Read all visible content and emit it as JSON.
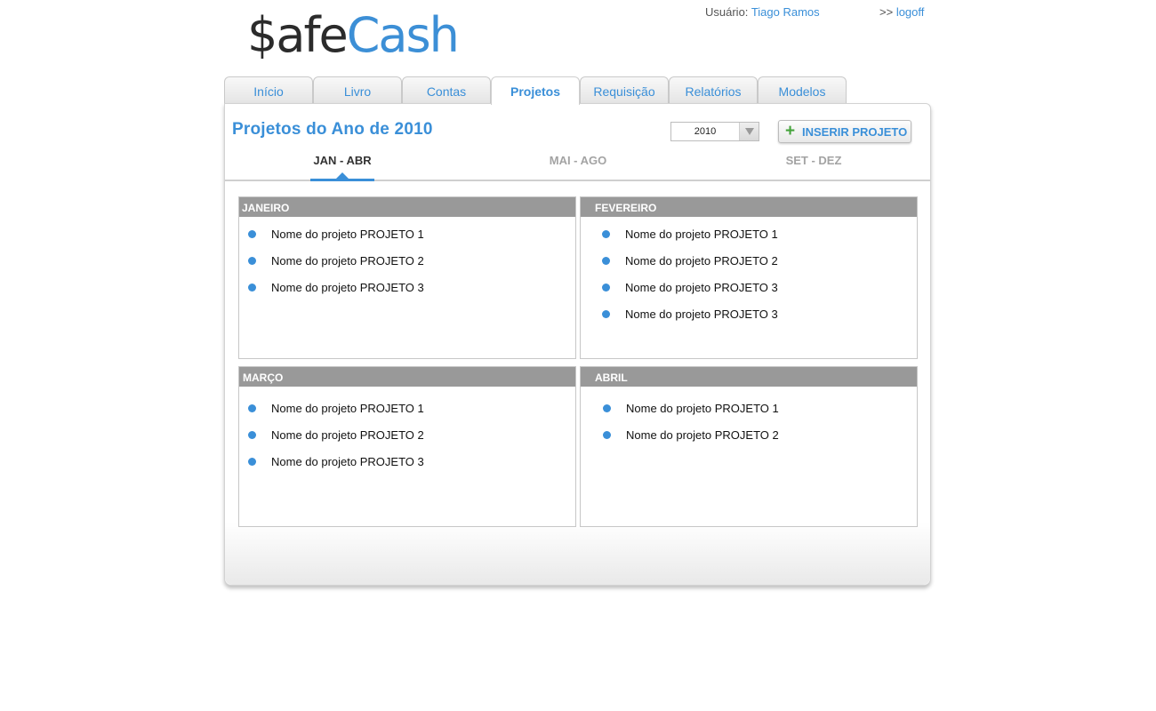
{
  "logo": {
    "part1": "$afe",
    "part2": "Cash"
  },
  "header": {
    "user_label": "Usuário:",
    "user_name": "Tiago Ramos",
    "logoff_prefix": ">>",
    "logoff_label": "logoff"
  },
  "tabs": [
    {
      "label": "Início"
    },
    {
      "label": "Livro"
    },
    {
      "label": "Contas"
    },
    {
      "label": "Projetos",
      "active": true
    },
    {
      "label": "Requisição"
    },
    {
      "label": "Relatórios"
    },
    {
      "label": "Modelos"
    }
  ],
  "page": {
    "title": "Projetos do Ano de 2010",
    "year_select": "2010",
    "insert_button": "INSERIR PROJETO",
    "insert_icon": "plus-icon"
  },
  "periods": [
    {
      "label": "JAN - ABR",
      "active": true
    },
    {
      "label": "MAI - AGO"
    },
    {
      "label": "SET - DEZ"
    }
  ],
  "months": [
    {
      "name": "JANEIRO",
      "projects": [
        "Nome do projeto PROJETO 1",
        "Nome do projeto PROJETO 2",
        "Nome do projeto PROJETO 3"
      ]
    },
    {
      "name": "FEVEREIRO",
      "projects": [
        "Nome do projeto PROJETO 1",
        "Nome do projeto PROJETO 2",
        "Nome do projeto PROJETO 3",
        "Nome do projeto PROJETO 3"
      ]
    },
    {
      "name": "MARÇO",
      "projects": [
        "Nome do projeto PROJETO 1",
        "Nome do projeto PROJETO 2",
        "Nome do projeto PROJETO 3"
      ]
    },
    {
      "name": "ABRIL",
      "projects": [
        "Nome do projeto PROJETO 1",
        "Nome do projeto PROJETO 2"
      ]
    }
  ],
  "colors": {
    "accent": "#3a8fd8",
    "month_header": "#999999",
    "add_icon": "#44a33b"
  }
}
